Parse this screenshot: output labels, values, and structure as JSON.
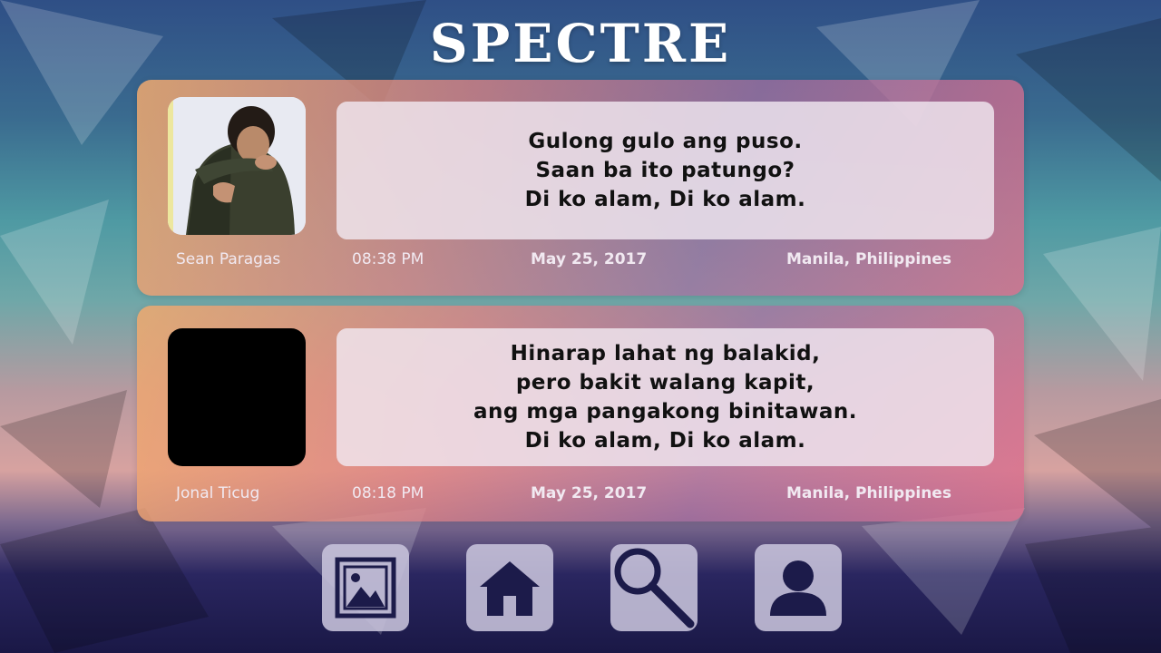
{
  "app": {
    "title": "SPECTRE"
  },
  "posts": [
    {
      "author": "Sean Paragas",
      "time": "08:38 PM",
      "date": "May 25, 2017",
      "location": "Manila, Philippines",
      "lines": [
        "Gulong gulo ang puso.",
        "Saan ba ito patungo?",
        "Di ko alam, Di ko alam."
      ]
    },
    {
      "author": "Jonal Ticug",
      "time": "08:18 PM",
      "date": "May 25, 2017",
      "location": "Manila, Philippines",
      "lines": [
        "Hinarap lahat ng balakid,",
        "pero bakit walang kapit,",
        "ang mga pangakong binitawan.",
        "Di ko alam, Di ko alam."
      ]
    }
  ],
  "nav": {
    "items": [
      {
        "icon": "image-gallery-icon"
      },
      {
        "icon": "home-icon"
      },
      {
        "icon": "search-icon"
      },
      {
        "icon": "profile-icon"
      }
    ]
  },
  "colors": {
    "icon": "#1c1b4a",
    "nav_button": "#c8c4dc",
    "title": "#ffffff"
  }
}
